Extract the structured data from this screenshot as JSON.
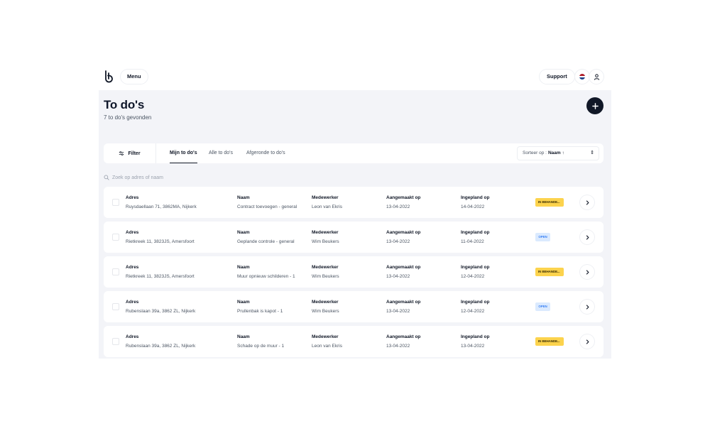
{
  "header": {
    "menu_label": "Menu",
    "support_label": "Support",
    "flag_colors": [
      "#ae1c28",
      "#ffffff",
      "#21468b"
    ]
  },
  "page": {
    "title": "To do's",
    "subtitle": "7 to do's gevonden"
  },
  "filterbar": {
    "filter_label": "Filter",
    "tabs": [
      {
        "label": "Mijn to do's",
        "active": true
      },
      {
        "label": "Alle to do's",
        "active": false
      },
      {
        "label": "Afgeronde to do's",
        "active": false
      }
    ],
    "sort_prefix": "Sorteer op :",
    "sort_value": "Naam ↑",
    "sort_toggle": "⇕"
  },
  "search": {
    "placeholder": "Zoek op adres of naam"
  },
  "columns": {
    "adres": "Adres",
    "naam": "Naam",
    "medewerker": "Medewerker",
    "aangemaakt": "Aangemaakt op",
    "ingepland": "Ingepland op"
  },
  "rows": [
    {
      "adres": "Ruysdaellaan 71, 3862MA, Nijkerk",
      "naam": "Contract toevoegen - general",
      "medewerker": "Leon van Ekris",
      "aangemaakt": "13-04-2022",
      "ingepland": "14-04-2022",
      "status": "IN BEHANDE...",
      "status_type": "yellow"
    },
    {
      "adres": "Rietkreek 11, 3823JS, Amersfoort",
      "naam": "Geplande controle - general",
      "medewerker": "Wim Beukers",
      "aangemaakt": "13-04-2022",
      "ingepland": "11-04-2022",
      "status": "OPEN",
      "status_type": "blue"
    },
    {
      "adres": "Rietkreek 11, 3823JS, Amersfoort",
      "naam": "Muur opnieuw schilderen - 1",
      "medewerker": "Wim Beukers",
      "aangemaakt": "13-04-2022",
      "ingepland": "12-04-2022",
      "status": "IN BEHANDE...",
      "status_type": "yellow"
    },
    {
      "adres": "Rubenslaan 39a, 3862 ZL, Nijkerk",
      "naam": "Prullenbak is kapot - 1",
      "medewerker": "Wim Beukers",
      "aangemaakt": "13-04-2022",
      "ingepland": "12-04-2022",
      "status": "OPEN",
      "status_type": "blue"
    },
    {
      "adres": "Rubenslaan 39a, 3862 ZL, Nijkerk",
      "naam": "Schade op de muur - 1",
      "medewerker": "Leon van Ekris",
      "aangemaakt": "13-04-2022",
      "ingepland": "13-04-2022",
      "status": "IN BEHANDE...",
      "status_type": "yellow"
    }
  ],
  "colors": {
    "panel_bg": "#f3f4f8",
    "primary": "#111827",
    "badge_yellow": "#fcd34d",
    "badge_blue": "#dbeafe"
  }
}
